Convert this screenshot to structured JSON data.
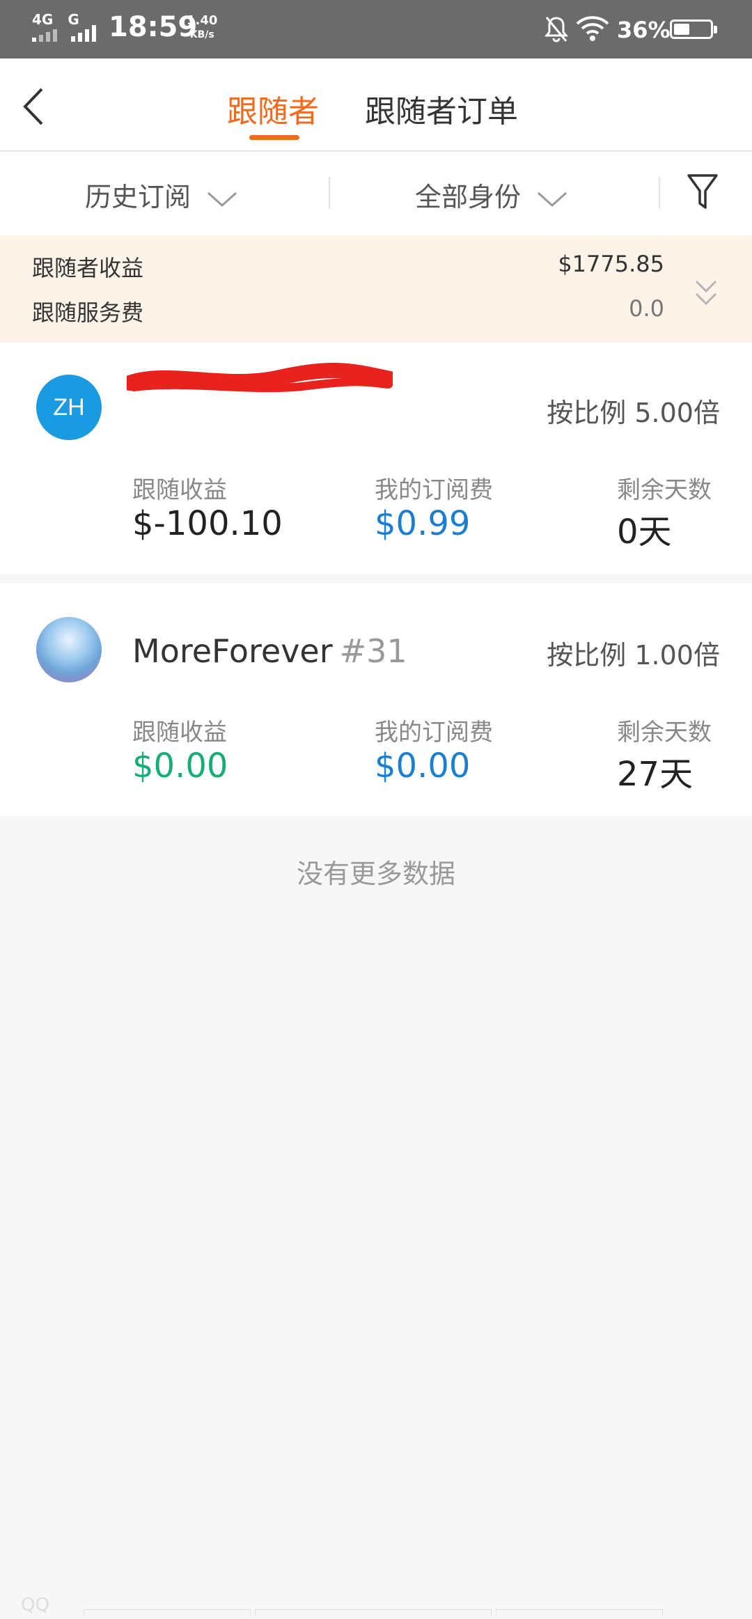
{
  "status_bar": {
    "net1": "4G",
    "net2": "G",
    "time": "18:59",
    "speed_value": "1.40",
    "speed_unit": "KB/s",
    "battery_pct": "36%",
    "battery_level": 0.36
  },
  "header": {
    "tabs": [
      {
        "label": "跟随者",
        "active": true
      },
      {
        "label": "跟随者订单",
        "active": false
      }
    ]
  },
  "filters": {
    "history": "历史订阅",
    "identity": "全部身份"
  },
  "summary": {
    "earnings_label": "跟随者收益",
    "earnings_value": "$1775.85",
    "fee_label": "跟随服务费",
    "fee_value": "0.0"
  },
  "followers": [
    {
      "avatar_text": "ZH",
      "name": "",
      "ratio": "按比例 5.00倍",
      "stats": [
        {
          "label": "跟随收益",
          "value": "$-100.10"
        },
        {
          "label": "我的订阅费",
          "value": "$0.99"
        },
        {
          "label": "剩余天数",
          "value": "0天"
        }
      ]
    },
    {
      "avatar_text": "",
      "name": "MoreForever",
      "number": "#31",
      "ratio": "按比例 1.00倍",
      "stats": [
        {
          "label": "跟随收益",
          "value": "$0.00"
        },
        {
          "label": "我的订阅费",
          "value": "$0.00"
        },
        {
          "label": "剩余天数",
          "value": "27天"
        }
      ]
    }
  ],
  "footer": {
    "no_more": "没有更多数据",
    "watermark": "QQ"
  },
  "colors": {
    "accent": "#f2691c",
    "blue": "#1a7fd0",
    "green": "#14ad74",
    "summary_bg": "#fdf3e8"
  }
}
